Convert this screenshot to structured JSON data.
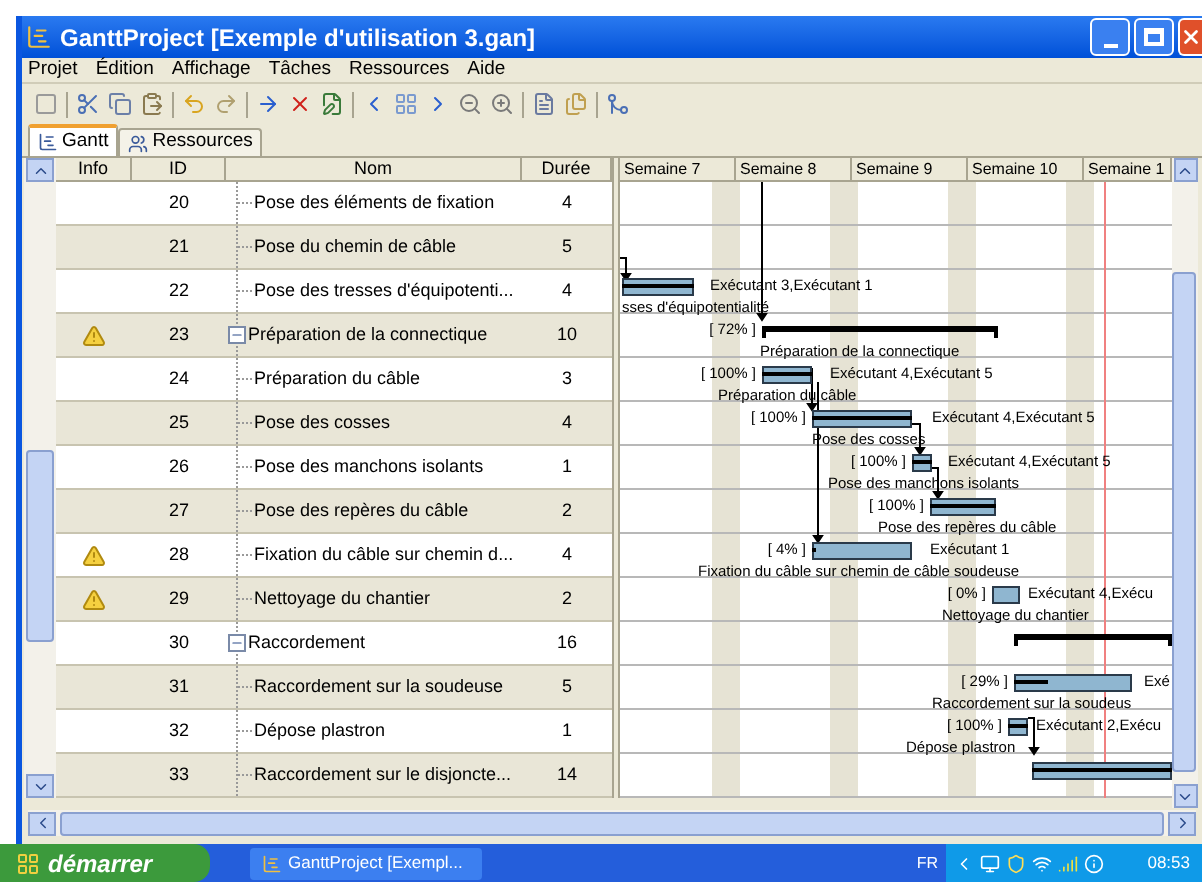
{
  "window": {
    "title": "GanttProject [Exemple d'utilisation 3.gan]"
  },
  "menu": [
    "Projet",
    "Édition",
    "Affichage",
    "Tâches",
    "Ressources",
    "Aide"
  ],
  "tabs": [
    {
      "label": "Gantt",
      "selected": true
    },
    {
      "label": "Ressources",
      "selected": false
    }
  ],
  "table": {
    "columns": [
      "Info",
      "ID",
      "Nom",
      "Durée"
    ],
    "rows": [
      {
        "children": [
          {
            "id": "20",
            "name": "Pose des éléments de fixation",
            "duration": "4",
            "warning": false
          },
          {
            "id": "21",
            "name": "Pose du chemin de câble",
            "duration": "5",
            "warning": false
          },
          {
            "id": "22",
            "name": "Pose des tresses d'équipotenti...",
            "duration": "4",
            "warning": false
          }
        ]
      },
      {
        "id": "23",
        "name": "Préparation de la connectique",
        "duration": "10",
        "warning": true,
        "expanded": true,
        "children": [
          {
            "id": "24",
            "name": "Préparation du câble",
            "duration": "3",
            "warning": false
          },
          {
            "id": "25",
            "name": "Pose des cosses",
            "duration": "4",
            "warning": false
          },
          {
            "id": "26",
            "name": "Pose des manchons isolants",
            "duration": "1",
            "warning": false
          },
          {
            "id": "27",
            "name": "Pose des repères du câble",
            "duration": "2",
            "warning": false
          },
          {
            "id": "28",
            "name": "Fixation du câble sur chemin d...",
            "duration": "4",
            "warning": true
          }
        ]
      },
      {
        "id": "29",
        "name": "Nettoyage du chantier",
        "duration": "2",
        "warning": true
      },
      {
        "id": "30",
        "name": "Raccordement",
        "duration": "16",
        "warning": false,
        "expanded": true,
        "children": [
          {
            "id": "31",
            "name": "Raccordement sur la soudeuse",
            "duration": "5",
            "warning": false
          },
          {
            "id": "32",
            "name": "Dépose plastron",
            "duration": "1",
            "warning": false
          },
          {
            "id": "33",
            "name": "Raccordement sur le disjoncte...",
            "duration": "14",
            "warning": false
          }
        ]
      }
    ]
  },
  "gantt": {
    "weeks": [
      "Semaine 7",
      "Semaine 8",
      "Semaine 9",
      "Semaine 10",
      "Semaine 1"
    ],
    "tasks": [
      {
        "kind": "empty"
      },
      {
        "kind": "empty"
      },
      {
        "kind": "task",
        "level": 1,
        "resources": "Exécutant 3,Exécutant 1",
        "label": "sses d'équipotentialité"
      },
      {
        "kind": "summary",
        "percent": "[ 72% ]",
        "label": "Préparation de la connectique"
      },
      {
        "kind": "task",
        "level": 1,
        "percent": "[ 100% ]",
        "resources": "Exécutant 4,Exécutant 5",
        "label": "Préparation du câble"
      },
      {
        "kind": "task",
        "level": 1,
        "percent": "[ 100% ]",
        "resources": "Exécutant 4,Exécutant 5",
        "label": "Pose des cosses"
      },
      {
        "kind": "task",
        "level": 1,
        "percent": "[ 100% ]",
        "resources": "Exécutant 4,Exécutant 5",
        "label": "Pose des manchons isolants"
      },
      {
        "kind": "task",
        "level": 1,
        "percent": "[ 100% ]",
        "label": "Pose des repères du câble"
      },
      {
        "kind": "task",
        "level": 0.04,
        "percent": "[ 4% ]",
        "resources": "Exécutant 1",
        "label": "Fixation du câble sur chemin de câble soudeuse"
      },
      {
        "kind": "task",
        "percent": "[ 0% ]",
        "resources": "Exécutant 4,Exécu",
        "label": "Nettoyage du chantier"
      },
      {
        "kind": "summary"
      },
      {
        "kind": "task",
        "level": 0.29,
        "percent": "[ 29% ]",
        "resources": "Exé",
        "label": "Raccordement sur la soudeus"
      },
      {
        "kind": "task",
        "level": 1,
        "percent": "[ 100% ]",
        "resources": "Exécutant 2,Exécu",
        "label": "Dépose plastron"
      },
      {
        "kind": "task",
        "level": 1
      }
    ]
  },
  "taskbar": {
    "start": "démarrer",
    "tasks": [
      "GanttProject [Exempl..."
    ],
    "language": "FR",
    "clock": "08:53"
  }
}
